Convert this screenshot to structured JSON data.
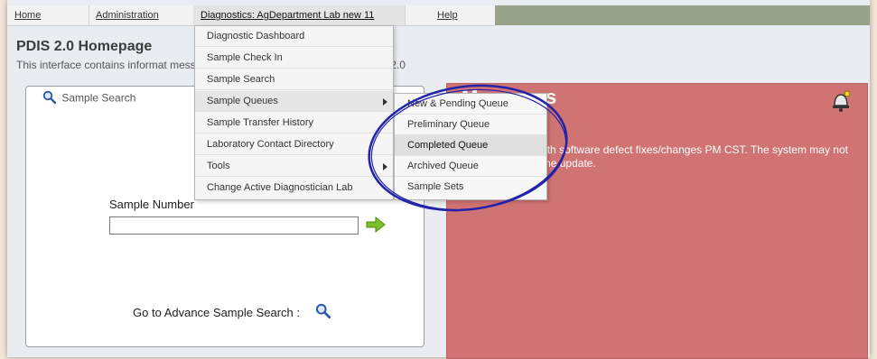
{
  "menubar": {
    "items": [
      {
        "label": "Home"
      },
      {
        "label": "Administration"
      },
      {
        "label": "Diagnostics: AgDepartment Lab new 11"
      },
      {
        "label": "Help"
      }
    ]
  },
  "page": {
    "title": "PDIS 2.0 Homepage",
    "subtitle": "This interface contains informat                                                                          messages, and new features relating to PDIS 2.0"
  },
  "diagnostics_menu": {
    "items": [
      {
        "label": "Diagnostic Dashboard"
      },
      {
        "label": "Sample Check In"
      },
      {
        "label": "Sample Search"
      },
      {
        "label": "Sample Queues"
      },
      {
        "label": "Sample Transfer History"
      },
      {
        "label": "Laboratory Contact Directory"
      },
      {
        "label": "Tools"
      },
      {
        "label": "Change Active Diagnostician Lab"
      }
    ]
  },
  "sample_queues_submenu": {
    "items": [
      {
        "label": "New & Pending Queue"
      },
      {
        "label": "Preliminary Queue"
      },
      {
        "label": "Completed Queue"
      },
      {
        "label": "Archived Queue"
      },
      {
        "label": "Sample Sets"
      }
    ]
  },
  "search_panel": {
    "legend": "Sample Search",
    "sample_number_label": "Sample Number",
    "sample_number_value": "",
    "advance_link": "Go to Advance Sample Search :"
  },
  "messages": {
    "title": "Messages",
    "text": "will be updated with software defect fixes/changes PM CST. The system may not be stable during the update."
  },
  "colors": {
    "messages_bg": "#d07373",
    "annotation": "#2222aa",
    "menu_accent": "#97a289"
  },
  "icons": {
    "search": "magnifier-icon",
    "go": "green-arrow-icon",
    "bell": "bell-icon"
  }
}
